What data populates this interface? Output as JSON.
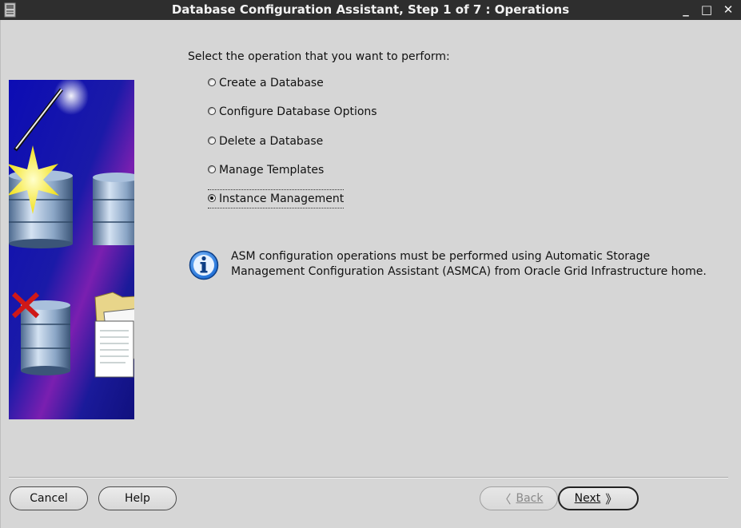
{
  "window": {
    "title": "Database Configuration Assistant, Step 1 of 7 : Operations",
    "controls": {
      "minimize": "_",
      "maximize": "□",
      "close": "✕"
    }
  },
  "main": {
    "prompt": "Select the operation that you want to perform:",
    "operations": [
      {
        "label": "Create a Database",
        "selected": false
      },
      {
        "label": "Configure Database Options",
        "selected": false
      },
      {
        "label": "Delete a Database",
        "selected": false
      },
      {
        "label": "Manage Templates",
        "selected": false
      },
      {
        "label": "Instance Management",
        "selected": true
      }
    ],
    "info": {
      "icon": "info-icon",
      "line1": "ASM configuration operations must be performed using Automatic Storage",
      "line2": "Management Configuration Assistant (ASMCA) from Oracle Grid Infrastructure home."
    }
  },
  "footer": {
    "cancel_label": "Cancel",
    "help_label": "Help",
    "back_label": "Back",
    "back_glyph": "〈",
    "next_label": "Next",
    "next_glyph": "》"
  },
  "colors": {
    "titlebar": "#2e2e2e",
    "background": "#d6d6d6",
    "illustration_blue": "#1a1aa8",
    "illustration_purple": "#7a1fb0",
    "check_red": "#d01818",
    "info_blue": "#1f6fd6"
  }
}
